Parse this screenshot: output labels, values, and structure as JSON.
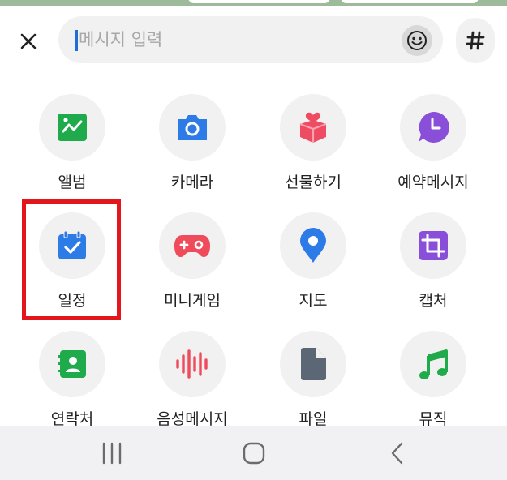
{
  "composer": {
    "placeholder": "메시지 입력",
    "value": ""
  },
  "attachments": [
    {
      "label": "앨범",
      "icon": "album-icon",
      "color": "#1faa4b"
    },
    {
      "label": "카메라",
      "icon": "camera-icon",
      "color": "#2d7be6"
    },
    {
      "label": "선물하기",
      "icon": "gift-icon",
      "color": "#ef4b63"
    },
    {
      "label": "예약메시지",
      "icon": "scheduled-message-icon",
      "color": "#8a4fd8"
    },
    {
      "label": "일정",
      "icon": "calendar-icon",
      "color": "#2d7be6"
    },
    {
      "label": "미니게임",
      "icon": "gamepad-icon",
      "color": "#ef4b5b"
    },
    {
      "label": "지도",
      "icon": "map-pin-icon",
      "color": "#2d7be6"
    },
    {
      "label": "캡처",
      "icon": "crop-icon",
      "color": "#8a4fd8"
    },
    {
      "label": "연락처",
      "icon": "contact-icon",
      "color": "#1faa4b"
    },
    {
      "label": "음성메시지",
      "icon": "voice-message-icon",
      "color": "#ef4b5b"
    },
    {
      "label": "파일",
      "icon": "file-icon",
      "color": "#5c6775"
    },
    {
      "label": "뮤직",
      "icon": "music-icon",
      "color": "#1faa4b"
    }
  ],
  "highlighted_item": "일정",
  "colors": {
    "highlight": "#e3161c",
    "caret": "#1d6fd6"
  }
}
